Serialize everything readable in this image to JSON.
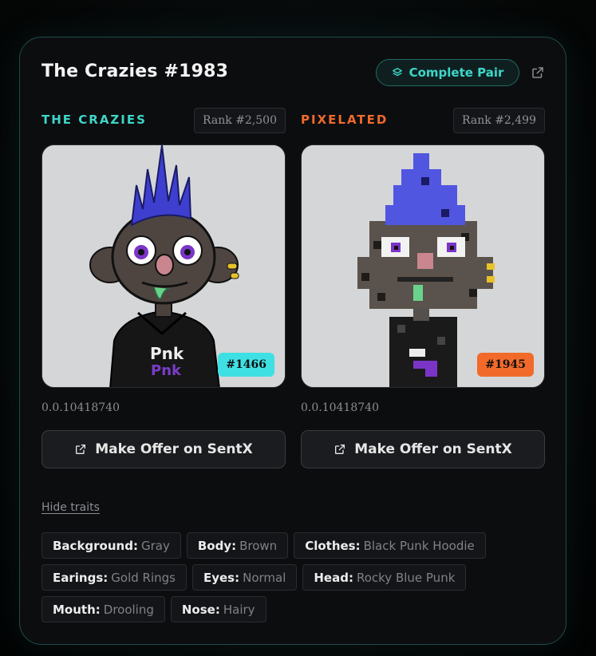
{
  "title": "The Crazies #1983",
  "complete_pair_label": "Complete Pair",
  "colors": {
    "teal": "#3ed6c8",
    "orange": "#f06a2c",
    "badge_teal": "#3ee0e4",
    "badge_orange": "#f26a2a"
  },
  "collections": [
    {
      "label": "THE CRAZIES",
      "rank": "Rank #2,500",
      "badge": "#1466",
      "token_id": "0.0.10418740",
      "offer_label": "Make Offer on SentX"
    },
    {
      "label": "PIXELATED",
      "rank": "Rank #2,499",
      "badge": "#1945",
      "token_id": "0.0.10418740",
      "offer_label": "Make Offer on SentX"
    }
  ],
  "hide_traits_label": "Hide traits",
  "traits": [
    {
      "key": "Background:",
      "value": "Gray"
    },
    {
      "key": "Body:",
      "value": "Brown"
    },
    {
      "key": "Clothes:",
      "value": "Black Punk Hoodie"
    },
    {
      "key": "Earings:",
      "value": "Gold Rings"
    },
    {
      "key": "Eyes:",
      "value": "Normal"
    },
    {
      "key": "Head:",
      "value": "Rocky Blue Punk"
    },
    {
      "key": "Mouth:",
      "value": "Drooling"
    },
    {
      "key": "Nose:",
      "value": "Hairy"
    }
  ]
}
